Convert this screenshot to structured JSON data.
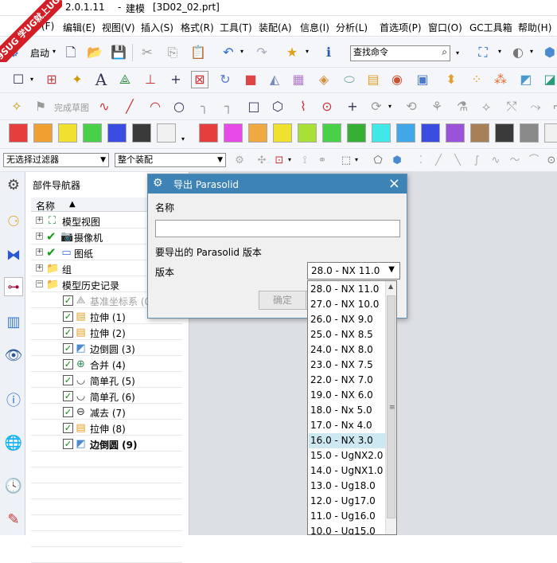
{
  "window": {
    "version_fragment": "2.0.1.11",
    "app_mode": "建模",
    "file": "[3D02_02.prt]",
    "watermark": "9SUG 学UG就上UG网"
  },
  "menubar": {
    "items": [
      "(F)",
      "编辑(E)",
      "视图(V)",
      "插入(S)",
      "格式(R)",
      "工具(T)",
      "装配(A)",
      "信息(I)",
      "分析(L)",
      "首选项(P)",
      "窗口(O)",
      "GC工具箱",
      "帮助(H)"
    ]
  },
  "toolbar1": {
    "start_label": "启动",
    "search_placeholder": "查找命令"
  },
  "toolbar3": {
    "sketch_label": "完成草图"
  },
  "color_bar": {
    "left": [
      "#e63d3d",
      "#f0a030",
      "#f0e030",
      "#48d048",
      "#3a4de0",
      "#3a3a3a",
      "#f0f0f0"
    ],
    "right": [
      "#e63d3d",
      "#e84ae8",
      "#f0a840",
      "#f0e030",
      "#a8e038",
      "#48d048",
      "#35b035",
      "#40e8e8",
      "#40a8e8",
      "#3a4de0",
      "#9a52d8",
      "#a88058",
      "#3a3a3a",
      "#8a8a8a",
      "#f0f0f0"
    ]
  },
  "filter_bar": {
    "filter_value": "无选择过滤器",
    "scope_value": "整个装配"
  },
  "navigator": {
    "title": "部件导航器",
    "column_name": "名称",
    "top_nodes": [
      {
        "label": "模型视图",
        "icon": "model-views-icon",
        "check": false
      },
      {
        "label": "摄像机",
        "icon": "camera-icon",
        "check": true
      },
      {
        "label": "图纸",
        "icon": "drawing-icon",
        "check": true
      },
      {
        "label": "组",
        "icon": "folder-icon",
        "check": false
      },
      {
        "label": "模型历史记录",
        "icon": "folder-icon",
        "check": false
      }
    ],
    "history": [
      {
        "label": "基准坐标系 (0",
        "icon": "datum-csys-icon",
        "dim": true,
        "bold": false
      },
      {
        "label": "拉伸 (1)",
        "icon": "extrude-icon",
        "dim": false,
        "bold": false
      },
      {
        "label": "拉伸 (2)",
        "icon": "extrude-icon",
        "dim": false,
        "bold": false
      },
      {
        "label": "边倒圆 (3)",
        "icon": "edge-blend-icon",
        "dim": false,
        "bold": false
      },
      {
        "label": "合并 (4)",
        "icon": "unite-icon",
        "dim": false,
        "bold": false
      },
      {
        "label": "简单孔 (5)",
        "icon": "hole-icon",
        "dim": false,
        "bold": false
      },
      {
        "label": "简单孔 (6)",
        "icon": "hole-icon",
        "dim": false,
        "bold": false
      },
      {
        "label": "减去 (7)",
        "icon": "subtract-icon",
        "dim": false,
        "bold": false
      },
      {
        "label": "拉伸 (8)",
        "icon": "extrude-icon",
        "dim": false,
        "bold": false
      },
      {
        "label": "边倒圆 (9)",
        "icon": "edge-blend-icon",
        "dim": false,
        "bold": true
      }
    ]
  },
  "dialog": {
    "title": "导出 Parasolid",
    "name_label": "名称",
    "name_value": "",
    "section_label": "要导出的 Parasolid 版本",
    "version_label": "版本",
    "version_value": "28.0 - NX 11.0",
    "ok_label": "确定",
    "versions": [
      "28.0 - NX 11.0",
      "27.0 - NX 10.0",
      "26.0 - NX 9.0",
      "25.0 - NX 8.5",
      "24.0 - NX 8.0",
      "23.0 - NX 7.5",
      "22.0 - NX 7.0",
      "19.0 - NX 6.0",
      "18.0 - Nx 5.0",
      "17.0 - Nx 4.0",
      "16.0 - NX 3.0",
      "15.0 - UgNX2.0",
      "14.0 - UgNX1.0",
      "13.0 - Ug18.0",
      "12.0 - Ug17.0",
      "11.0 - Ug16.0",
      "10.0 - Ug15.0"
    ],
    "highlighted_version": "16.0 - NX 3.0"
  }
}
